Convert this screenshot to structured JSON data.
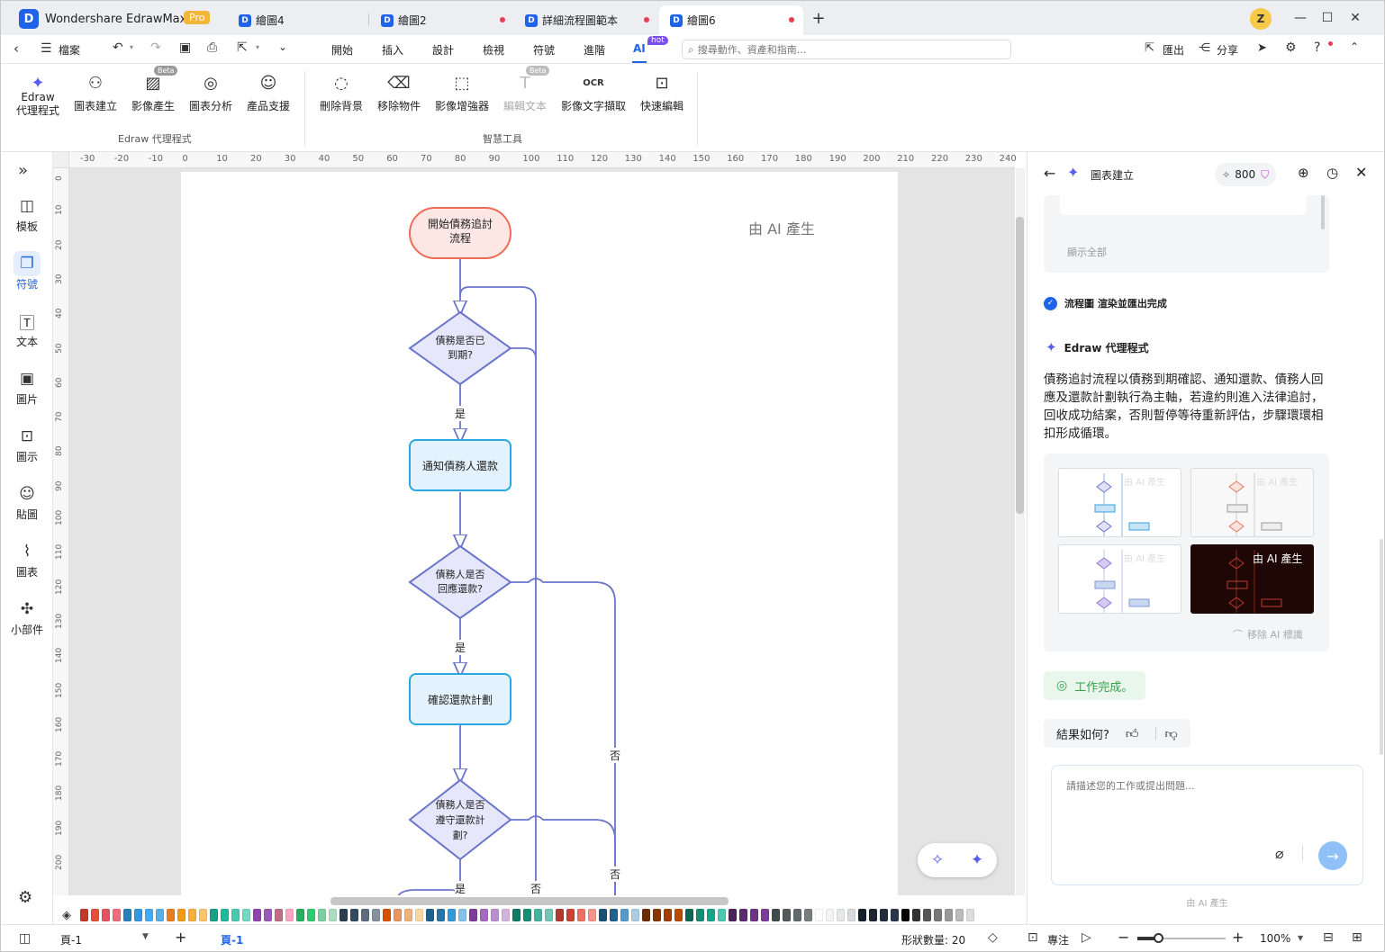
{
  "titlebar": {
    "brand": "Wondershare EdrawMax",
    "pro_badge": "Pro",
    "tabs": [
      {
        "label": "繪圖4",
        "unsaved": false
      },
      {
        "label": "繪圖2",
        "unsaved": true
      },
      {
        "label": "詳細流程圖範本",
        "unsaved": true
      },
      {
        "label": "繪圖6",
        "unsaved": true,
        "active": true
      }
    ],
    "user_initial": "Z"
  },
  "menubar": {
    "file": "檔案",
    "items": [
      "開始",
      "插入",
      "設計",
      "檢視",
      "符號",
      "進階",
      "AI"
    ],
    "ai_badge": "hot",
    "search_placeholder": "搜尋動作、資產和指南...",
    "export": "匯出",
    "share": "分享"
  },
  "ribbon": {
    "group1": {
      "label": "Edraw 代理程式",
      "buttons": [
        "Edraw\n代理程式",
        "圖表建立",
        "影像產生",
        "圖表分析",
        "產品支援"
      ],
      "beta": "Beta"
    },
    "group2": {
      "label": "智慧工具",
      "buttons": [
        "刪除背景",
        "移除物件",
        "影像增強器",
        "編輯文本",
        "影像文字擷取",
        "快速編輯"
      ],
      "beta": "Beta"
    }
  },
  "leftbar": [
    "模板",
    "符號",
    "文本",
    "圖片",
    "圖示",
    "貼圖",
    "圖表",
    "小部件"
  ],
  "ruler": {
    "top": [
      "-30",
      "-20",
      "-10",
      "0",
      "10",
      "20",
      "30",
      "40",
      "50",
      "60",
      "70",
      "80",
      "90",
      "100",
      "110",
      "120",
      "130",
      "140",
      "150",
      "160",
      "170",
      "180",
      "190",
      "200",
      "210",
      "220",
      "230",
      "240"
    ],
    "left": [
      "0",
      "10",
      "20",
      "30",
      "40",
      "50",
      "60",
      "70",
      "80",
      "90",
      "100",
      "110",
      "120",
      "130",
      "140",
      "150",
      "160",
      "170",
      "180",
      "190",
      "200"
    ]
  },
  "diagram": {
    "watermark": "由 AI 產生",
    "start": "開始債務追討\n流程",
    "d1": "債務是否已\n到期?",
    "p1": "通知債務人還款",
    "d2": "債務人是否\n回應還款?",
    "p2": "確認還款計劃",
    "d3": "債務人是否\n遵守還款計\n劃?",
    "yes": "是",
    "no": "否"
  },
  "palette_colors": [
    "#c0392b",
    "#e74c3c",
    "#e05561",
    "#f06c7d",
    "#2980b9",
    "#3498db",
    "#45aaf2",
    "#5dade2",
    "#e67e22",
    "#f39c12",
    "#f5b041",
    "#f8c471",
    "#16a085",
    "#1abc9c",
    "#48c9b0",
    "#76d7c4",
    "#8e44ad",
    "#9b59b6",
    "#c06c84",
    "#f8a5c2",
    "#27ae60",
    "#2ecc71",
    "#7dcea0",
    "#a9dfbf",
    "#2c3e50",
    "#34495e",
    "#5d6d7e",
    "#85929e",
    "#d35400",
    "#e59866",
    "#f0b27a",
    "#fad7a0",
    "#1f618d",
    "#2874a6",
    "#3498db",
    "#85c1e9",
    "#7d3c98",
    "#a569bd",
    "#bb8fce",
    "#d2b4de",
    "#117a65",
    "#148f77",
    "#45b39d",
    "#73c6b6",
    "#b03a2e",
    "#cb4335",
    "#ec7063",
    "#f1948a",
    "#1a5276",
    "#21618c",
    "#5499c7",
    "#a9cce3",
    "#6e2c00",
    "#873600",
    "#a04000",
    "#ba4a00",
    "#0e6655",
    "#138d75",
    "#17a589",
    "#48c9b0",
    "#4a235a",
    "#5b2c6f",
    "#6c3483",
    "#7d3c98",
    "#424949",
    "#515a5a",
    "#616a6b",
    "#797d7f",
    "#ffffff",
    "#f2f3f4",
    "#e5e7e9",
    "#d7dbdd",
    "#17202a",
    "#1b2631",
    "#212f3c",
    "#283747",
    "#000000",
    "#333333",
    "#555555",
    "#777777",
    "#999999",
    "#bbbbbb",
    "#dddddd"
  ],
  "status": {
    "page_select": "頁-1",
    "page_tab": "頁-1",
    "shape_count": "形狀數量: 20",
    "focus": "專注",
    "zoom": "100%"
  },
  "rpanel": {
    "title": "圖表建立",
    "credits": "800",
    "show_all": "顯示全部",
    "done_line": "流程圖 渲染並匯出完成",
    "agent_name": "Edraw 代理程式",
    "summary": "債務追討流程以債務到期確認、通知還款、債務人回應及還款計劃執行為主軸，若違約則進入法律追討，回收成功結案，否則暫停等待重新評估，步驟環環相扣形成循環。",
    "thumb_watermark": "由 AI 產生",
    "remove_watermark": "移除 AI 標識",
    "work_done": "工作完成。",
    "feedback_q": "結果如何?",
    "input_placeholder": "請描述您的工作或提出問題...",
    "footer": "由 AI 產生"
  }
}
